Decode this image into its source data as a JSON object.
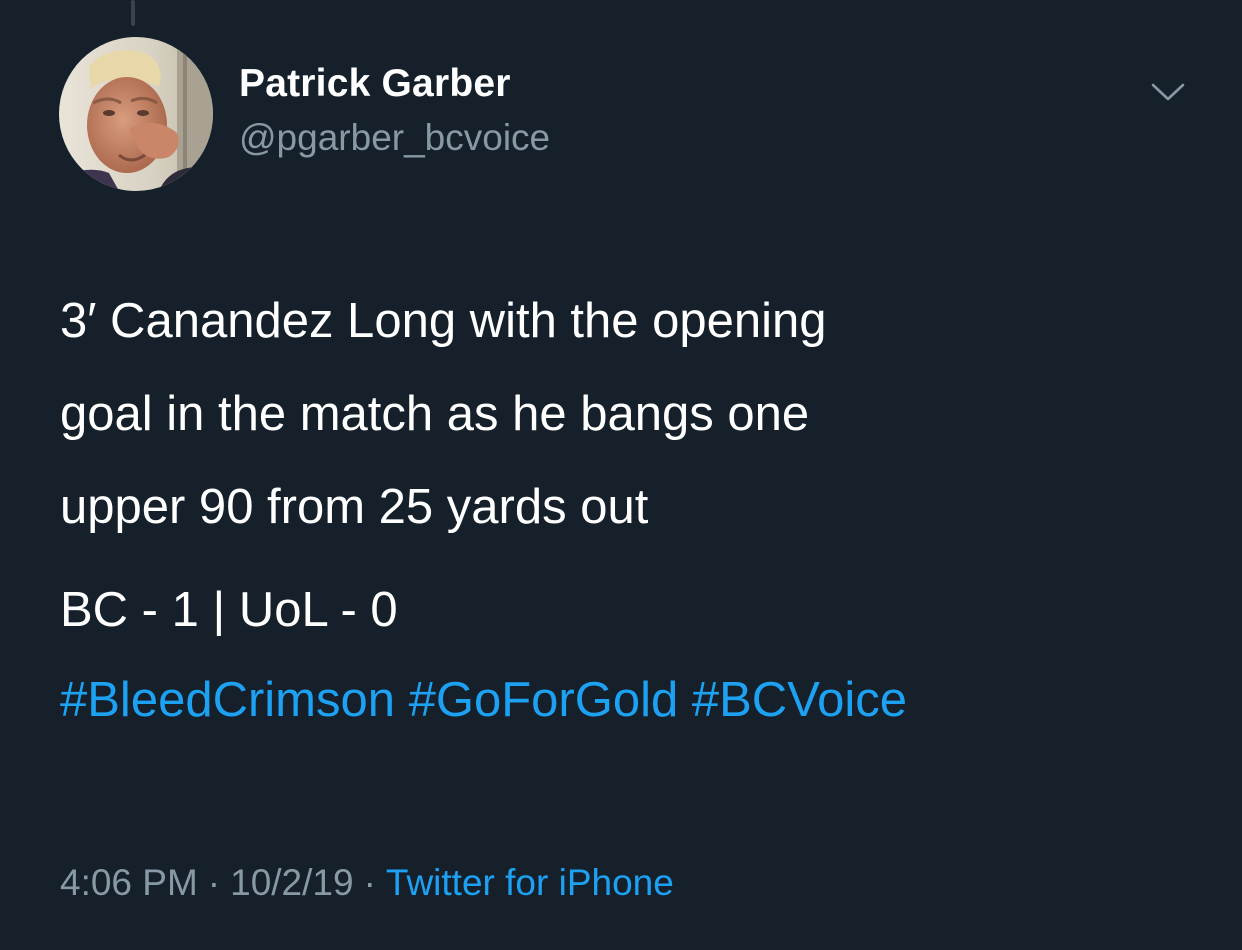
{
  "author": {
    "display_name": "Patrick Garber",
    "handle": "@pgarber_bcvoice"
  },
  "tweet": {
    "text_lines": [
      "3′ Canandez Long with the opening",
      "goal in the match as he bangs one",
      "upper 90 from 25 yards out"
    ],
    "score": "BC - 1 | UoL - 0",
    "hashtags": [
      "#BleedCrimson",
      "#GoForGold",
      "#BCVoice"
    ]
  },
  "meta": {
    "time": "4:06 PM",
    "date": "10/2/19",
    "separator": "·",
    "source": "Twitter for iPhone"
  },
  "icons": {
    "more_options": "chevron-down-icon"
  },
  "colors": {
    "background": "#15202b",
    "text": "#ffffff",
    "secondary_text": "#8899a6",
    "link": "#1da1f2"
  }
}
